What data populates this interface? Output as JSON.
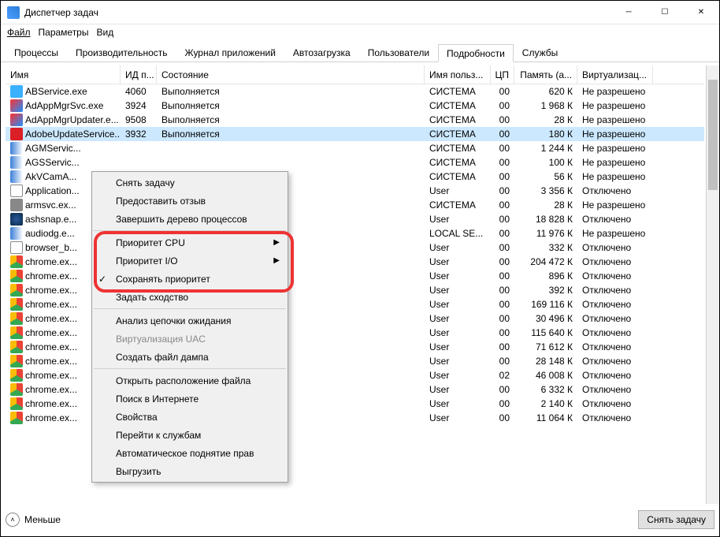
{
  "window": {
    "title": "Диспетчер задач"
  },
  "menubar": {
    "file": "Файл",
    "options": "Параметры",
    "view": "Вид"
  },
  "tabs": [
    "Процессы",
    "Производительность",
    "Журнал приложений",
    "Автозагрузка",
    "Пользователи",
    "Подробности",
    "Службы"
  ],
  "active_tab": 5,
  "columns": {
    "name": "Имя",
    "pid": "ИД п...",
    "state": "Состояние",
    "user": "Имя польз...",
    "cpu": "ЦП",
    "mem": "Память (а...",
    "virt": "Виртуализац..."
  },
  "rows": [
    {
      "icon": "ic-ab",
      "name": "ABService.exe",
      "pid": "4060",
      "state": "Выполняется",
      "user": "СИСТЕМА",
      "cpu": "00",
      "mem": "620 К",
      "virt": "Не разрешено"
    },
    {
      "icon": "ic-a",
      "name": "AdAppMgrSvc.exe",
      "pid": "3924",
      "state": "Выполняется",
      "user": "СИСТЕМА",
      "cpu": "00",
      "mem": "1 968 К",
      "virt": "Не разрешено"
    },
    {
      "icon": "ic-a",
      "name": "AdAppMgrUpdater.e...",
      "pid": "9508",
      "state": "Выполняется",
      "user": "СИСТЕМА",
      "cpu": "00",
      "mem": "28 К",
      "virt": "Не разрешено"
    },
    {
      "icon": "ic-adobe",
      "name": "AdobeUpdateService...",
      "pid": "3932",
      "state": "Выполняется",
      "user": "СИСТЕМА",
      "cpu": "00",
      "mem": "180 К",
      "virt": "Не разрешено",
      "selected": true
    },
    {
      "icon": "ic-agm",
      "name": "AGMServic...",
      "pid": "",
      "state": "",
      "user": "СИСТЕМА",
      "cpu": "00",
      "mem": "1 244 К",
      "virt": "Не разрешено"
    },
    {
      "icon": "ic-agm",
      "name": "AGSServic...",
      "pid": "",
      "state": "",
      "user": "СИСТЕМА",
      "cpu": "00",
      "mem": "100 К",
      "virt": "Не разрешено"
    },
    {
      "icon": "ic-agm",
      "name": "AkVCamA...",
      "pid": "",
      "state": "",
      "user": "СИСТЕМА",
      "cpu": "00",
      "mem": "56 К",
      "virt": "Не разрешено"
    },
    {
      "icon": "ic-app",
      "name": "Application...",
      "pid": "",
      "state": "",
      "user": "User",
      "cpu": "00",
      "mem": "3 356 К",
      "virt": "Отключено"
    },
    {
      "icon": "ic-gear",
      "name": "armsvc.ex...",
      "pid": "",
      "state": "",
      "user": "СИСТЕМА",
      "cpu": "00",
      "mem": "28 К",
      "virt": "Не разрешено"
    },
    {
      "icon": "ic-ash",
      "name": "ashsnap.e...",
      "pid": "",
      "state": "",
      "user": "User",
      "cpu": "00",
      "mem": "18 828 К",
      "virt": "Отключено"
    },
    {
      "icon": "ic-agm",
      "name": "audiodg.e...",
      "pid": "",
      "state": "",
      "user": "LOCAL SE...",
      "cpu": "00",
      "mem": "11 976 К",
      "virt": "Не разрешено"
    },
    {
      "icon": "ic-app",
      "name": "browser_b...",
      "pid": "",
      "state": "",
      "user": "User",
      "cpu": "00",
      "mem": "332 К",
      "virt": "Отключено"
    },
    {
      "icon": "ic-chrome",
      "name": "chrome.ex...",
      "pid": "",
      "state": "",
      "user": "User",
      "cpu": "00",
      "mem": "204 472 К",
      "virt": "Отключено"
    },
    {
      "icon": "ic-chrome",
      "name": "chrome.ex...",
      "pid": "",
      "state": "",
      "user": "User",
      "cpu": "00",
      "mem": "896 К",
      "virt": "Отключено"
    },
    {
      "icon": "ic-chrome",
      "name": "chrome.ex...",
      "pid": "",
      "state": "",
      "user": "User",
      "cpu": "00",
      "mem": "392 К",
      "virt": "Отключено"
    },
    {
      "icon": "ic-chrome",
      "name": "chrome.ex...",
      "pid": "",
      "state": "",
      "user": "User",
      "cpu": "00",
      "mem": "169 116 К",
      "virt": "Отключено"
    },
    {
      "icon": "ic-chrome",
      "name": "chrome.ex...",
      "pid": "",
      "state": "",
      "user": "User",
      "cpu": "00",
      "mem": "30 496 К",
      "virt": "Отключено"
    },
    {
      "icon": "ic-chrome",
      "name": "chrome.ex...",
      "pid": "",
      "state": "",
      "user": "User",
      "cpu": "00",
      "mem": "115 640 К",
      "virt": "Отключено"
    },
    {
      "icon": "ic-chrome",
      "name": "chrome.ex...",
      "pid": "",
      "state": "",
      "user": "User",
      "cpu": "00",
      "mem": "71 612 К",
      "virt": "Отключено"
    },
    {
      "icon": "ic-chrome",
      "name": "chrome.ex...",
      "pid": "",
      "state": "",
      "user": "User",
      "cpu": "00",
      "mem": "28 148 К",
      "virt": "Отключено"
    },
    {
      "icon": "ic-chrome",
      "name": "chrome.ex...",
      "pid": "",
      "state": "",
      "user": "User",
      "cpu": "02",
      "mem": "46 008 К",
      "virt": "Отключено"
    },
    {
      "icon": "ic-chrome",
      "name": "chrome.ex...",
      "pid": "",
      "state": "",
      "user": "User",
      "cpu": "00",
      "mem": "6 332 К",
      "virt": "Отключено"
    },
    {
      "icon": "ic-chrome",
      "name": "chrome.ex...",
      "pid": "",
      "state": "",
      "user": "User",
      "cpu": "00",
      "mem": "2 140 К",
      "virt": "Отключено"
    },
    {
      "icon": "ic-chrome",
      "name": "chrome.ex...",
      "pid": "",
      "state": "",
      "user": "User",
      "cpu": "00",
      "mem": "11 064 К",
      "virt": "Отключено"
    }
  ],
  "context_menu": {
    "items": [
      {
        "label": "Снять задачу"
      },
      {
        "label": "Предоставить отзыв"
      },
      {
        "label": "Завершить дерево процессов"
      },
      {
        "sep": true
      },
      {
        "label": "Приоритет CPU",
        "submenu": true
      },
      {
        "label": "Приоритет I/O",
        "submenu": true
      },
      {
        "label": "Сохранять приоритет",
        "checked": true
      },
      {
        "label": "Задать сходство"
      },
      {
        "sep": true
      },
      {
        "label": "Анализ цепочки ожидания"
      },
      {
        "label": "Виртуализация UAC",
        "disabled": true
      },
      {
        "label": "Создать файл дампа"
      },
      {
        "sep": true
      },
      {
        "label": "Открыть расположение файла"
      },
      {
        "label": "Поиск в Интернете"
      },
      {
        "label": "Свойства"
      },
      {
        "label": "Перейти к службам"
      },
      {
        "label": "Автоматическое поднятие прав"
      },
      {
        "label": "Выгрузить"
      }
    ]
  },
  "footer": {
    "less": "Меньше",
    "endtask": "Снять задачу"
  }
}
